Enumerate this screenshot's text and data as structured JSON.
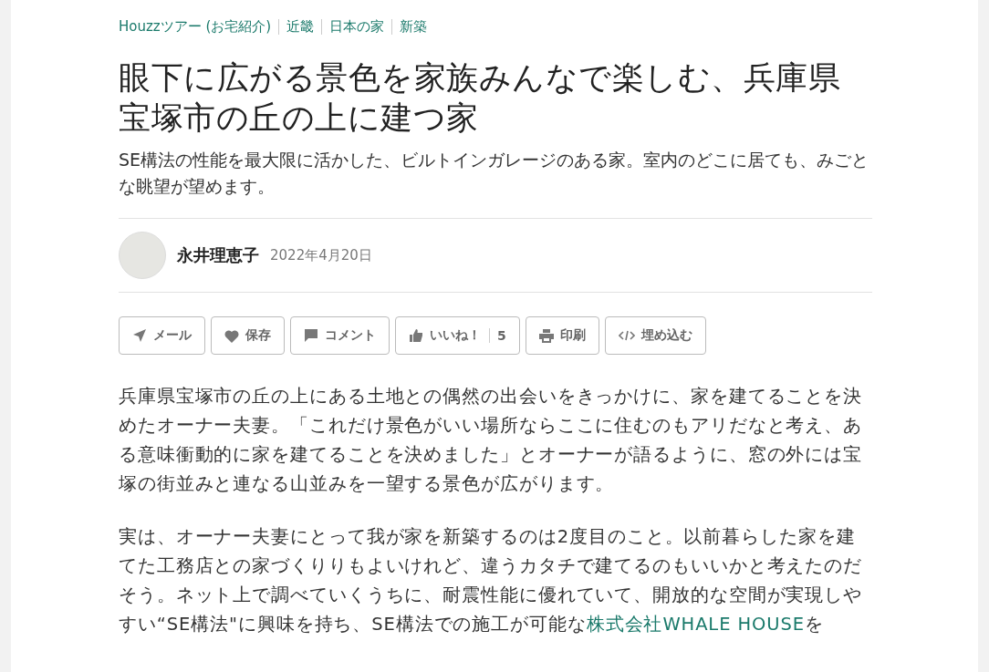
{
  "breadcrumbs": [
    "Houzzツアー (お宅紹介)",
    "近畿",
    "日本の家",
    "新築"
  ],
  "title": "眼下に広がる景色を家族みんなで楽しむ、兵庫県宝塚市の丘の上に建つ家",
  "subtitle": "SE構法の性能を最大限に活かした、ビルトインガレージのある家。室内のどこに居ても、みごとな眺望が望めます。",
  "author": {
    "name": "永井理恵子",
    "date": "2022年4月20日"
  },
  "buttons": [
    {
      "kind": "mail",
      "label": "メール"
    },
    {
      "kind": "save",
      "label": "保存"
    },
    {
      "kind": "comment",
      "label": "コメント"
    },
    {
      "kind": "like",
      "label": "いいね！",
      "count": "5"
    },
    {
      "kind": "print",
      "label": "印刷"
    },
    {
      "kind": "embed",
      "label": "埋め込む"
    }
  ],
  "paragraphs": [
    {
      "text": "兵庫県宝塚市の丘の上にある土地との偶然の出会いをきっかけに、家を建てることを決めたオーナー夫妻。「これだけ景色がいい場所ならここに住むのもアリだなと考え、ある意味衝動的に家を建てることを決めました」とオーナーが語るように、窓の外には宝塚の街並みと連なる山並みを一望する景色が広がります。"
    },
    {
      "text": "実は、オーナー夫妻にとって我が家を新築するのは2度目のこと。以前暮らした家を建てた工務店との家づくりりもよいけれど、違うカタチで建てるのもいいかと考えたのだそう。ネット上で調べていくうちに、耐震性能に優れていて、開放的な空間が実現しやすい“SE構法\"に興味を持ち、SE構法での施工が可能な",
      "link": "株式会社WHALE HOUSE",
      "after": "を"
    }
  ]
}
